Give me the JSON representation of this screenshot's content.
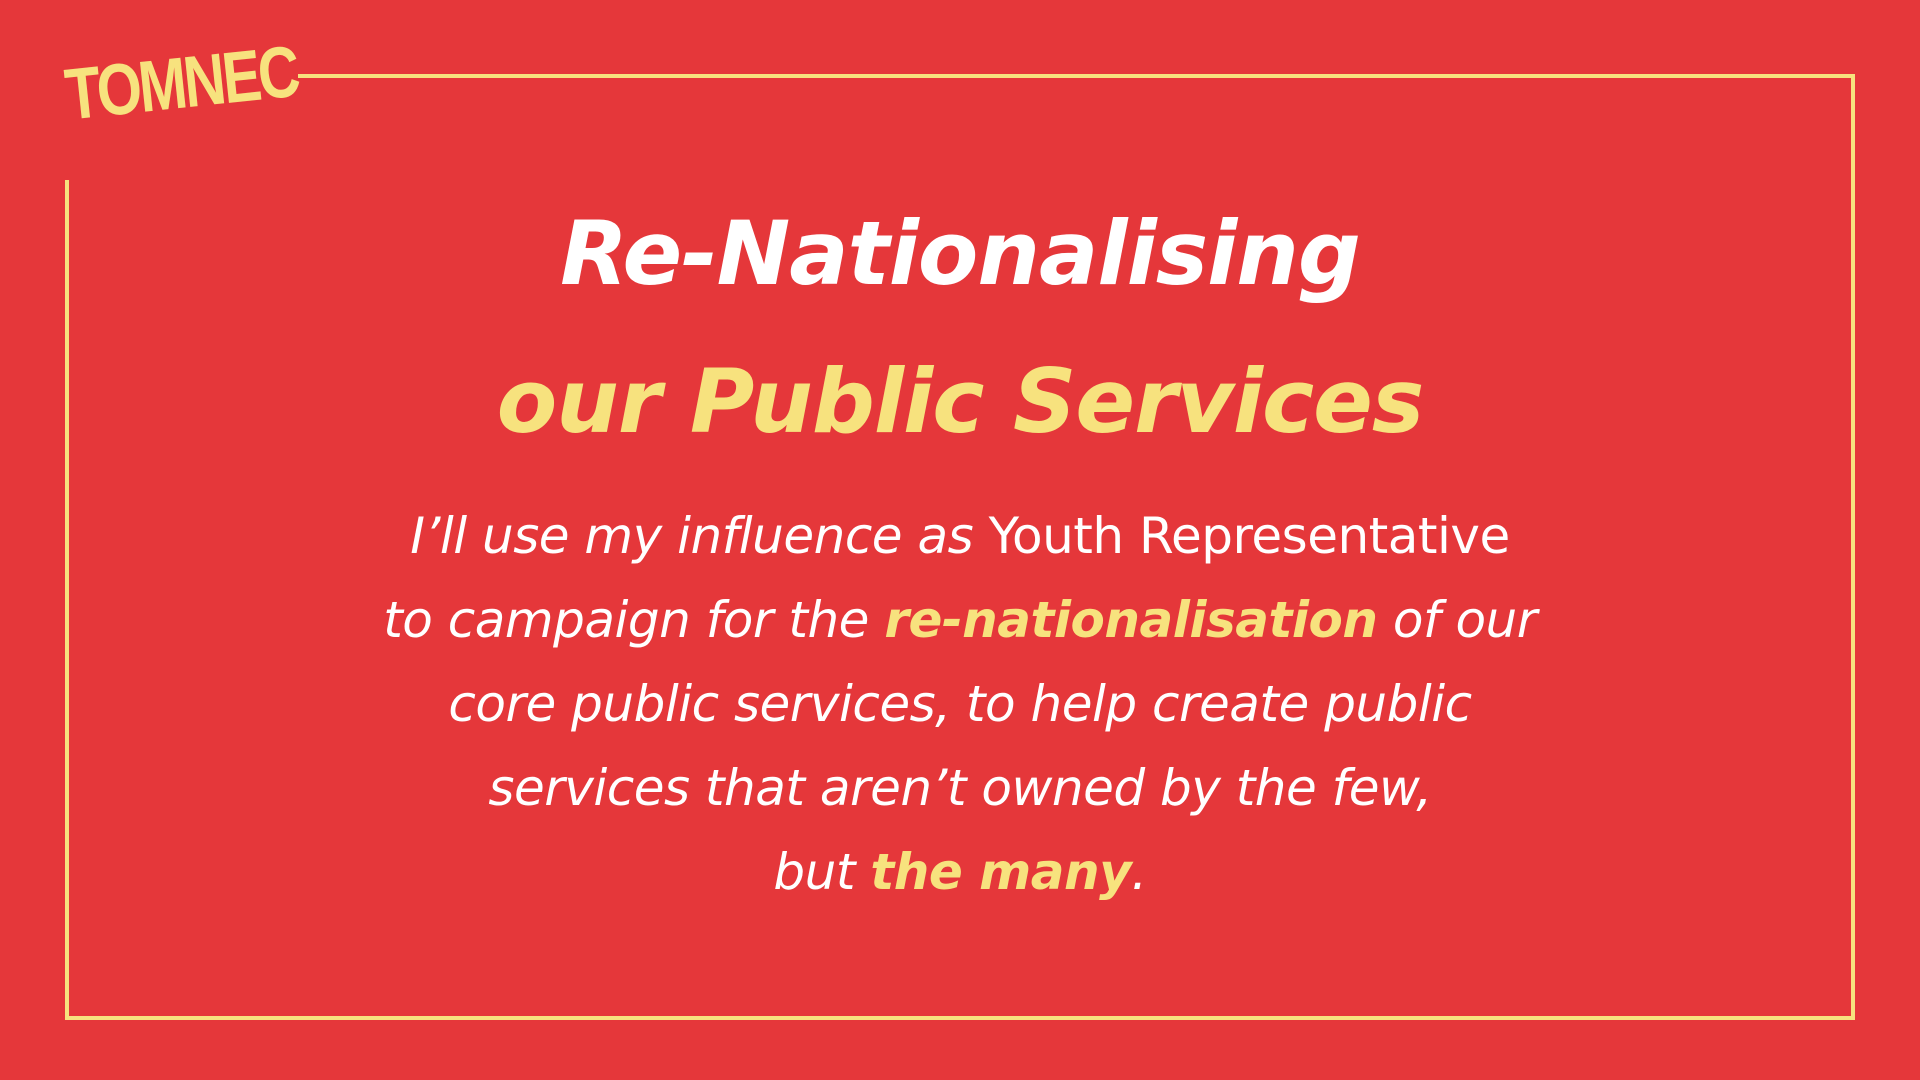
{
  "logo": {
    "text": "TOMNEC"
  },
  "colors": {
    "background": "#E5373A",
    "accent": "#F7E27E",
    "text": "#FFFFFF"
  },
  "headline": {
    "line1": "Re-Nationalising",
    "line2": "our Public Services"
  },
  "body": {
    "l1_italic": "I’ll use my influence",
    "l1_italic_as": "as",
    "l1_plain": "Youth Representative",
    "l2_pre": "to campaign for the",
    "l2_highlight": "re-nationalisation",
    "l2_post": "of our",
    "l3": "core public services, to help create public",
    "l4": "services that aren’t owned by the few,",
    "l5_pre": "but",
    "l5_highlight": "the many",
    "l5_post": "."
  }
}
